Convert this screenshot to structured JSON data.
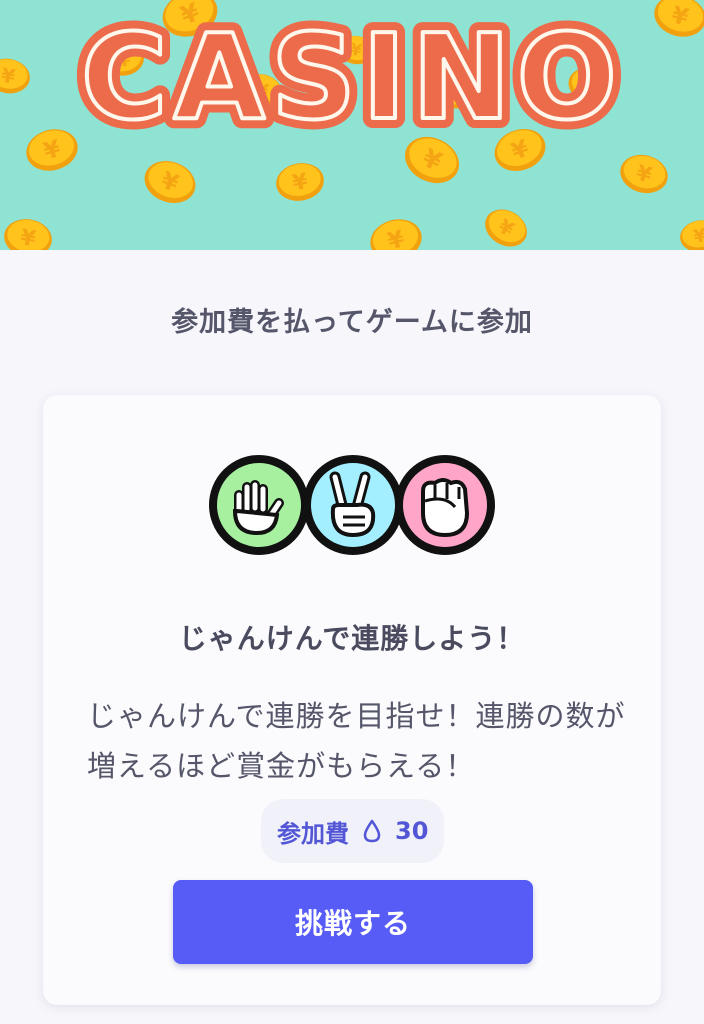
{
  "banner": {
    "logo_text": "CASINO",
    "coin_symbol": "¥",
    "colors": {
      "background": "#8ee3d3",
      "logo": "#ec6b4b",
      "coin": "#ffc31c"
    }
  },
  "join_heading": "参加費を払ってゲームに参加",
  "game": {
    "icons": [
      "paper-hand-icon",
      "scissors-hand-icon",
      "rock-fist-icon"
    ],
    "title": "じゃんけんで連勝しよう！",
    "description": "じゃんけんで連勝を目指せ！連勝の数が増えるほど賞金がもらえる！",
    "fee_label": "参加費",
    "fee_icon": "drop-icon",
    "fee_value": "30",
    "cta_label": "挑戦する"
  },
  "colors": {
    "accent": "#575cf6",
    "fee_text": "#5357d6",
    "paper_bg": "#a6f0a0",
    "scissors_bg": "#a4efff",
    "rock_bg": "#ffa6c8"
  }
}
